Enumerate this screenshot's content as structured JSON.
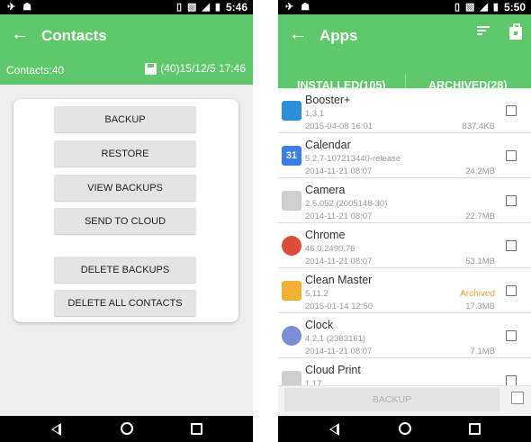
{
  "left": {
    "status_time": "5:46",
    "title": "Contacts",
    "contacts_count": "Contacts:40",
    "last_backup": "(40)15/12/5 17:46",
    "buttons": {
      "backup": "BACKUP",
      "restore": "RESTORE",
      "view_backups": "VIEW BACKUPS",
      "send_to_cloud": "SEND TO CLOUD",
      "delete_backups": "DELETE BACKUPS",
      "delete_all_contacts": "DELETE ALL CONTACTS"
    }
  },
  "right": {
    "status_time": "5:50",
    "title": "Apps",
    "tabs": [
      {
        "label": "INSTALLED(105)"
      },
      {
        "label": "ARCHIVED(28)"
      }
    ],
    "apps": [
      {
        "name": "Booster+",
        "version": "1.3.1",
        "date": "2015-04-08 16:01",
        "size": "837.4KB",
        "status": "",
        "icon": "booster-icon",
        "color": "#2d8fd8"
      },
      {
        "name": "Calendar",
        "version": "5.2.7-107213440-release",
        "date": "2014-11-21 08:07",
        "size": "24.2MB",
        "status": "",
        "icon": "calendar-icon",
        "color": "#3b7fe0",
        "icon_text": "31"
      },
      {
        "name": "Camera",
        "version": "2.5.052 (2005148-30)",
        "date": "2014-11-21 08:07",
        "size": "22.7MB",
        "status": "",
        "icon": "camera-icon",
        "color": "#d0d0d0"
      },
      {
        "name": "Chrome",
        "version": "46.0.2490.76",
        "date": "2014-11-21 08:07",
        "size": "53.1MB",
        "status": "",
        "icon": "chrome-icon",
        "color": "#dd4b39"
      },
      {
        "name": "Clean Master",
        "version": "5.11.2",
        "date": "2015-01-14 12:50",
        "size": "17.3MB",
        "status": "Archived",
        "icon": "clean-master-icon",
        "color": "#f2b134"
      },
      {
        "name": "Clock",
        "version": "4.2.1 (2383161)",
        "date": "2014-11-21 08:07",
        "size": "7.1MB",
        "status": "",
        "icon": "clock-icon",
        "color": "#7b8fd6"
      },
      {
        "name": "Cloud Print",
        "version": "1.17",
        "date": "",
        "size": "",
        "status": "",
        "icon": "cloud-print-icon",
        "color": "#cfcfcf"
      }
    ],
    "backup_label": "BACKUP"
  },
  "colors": {
    "accent": "#5ec86a",
    "archived": "#e8a33d"
  }
}
